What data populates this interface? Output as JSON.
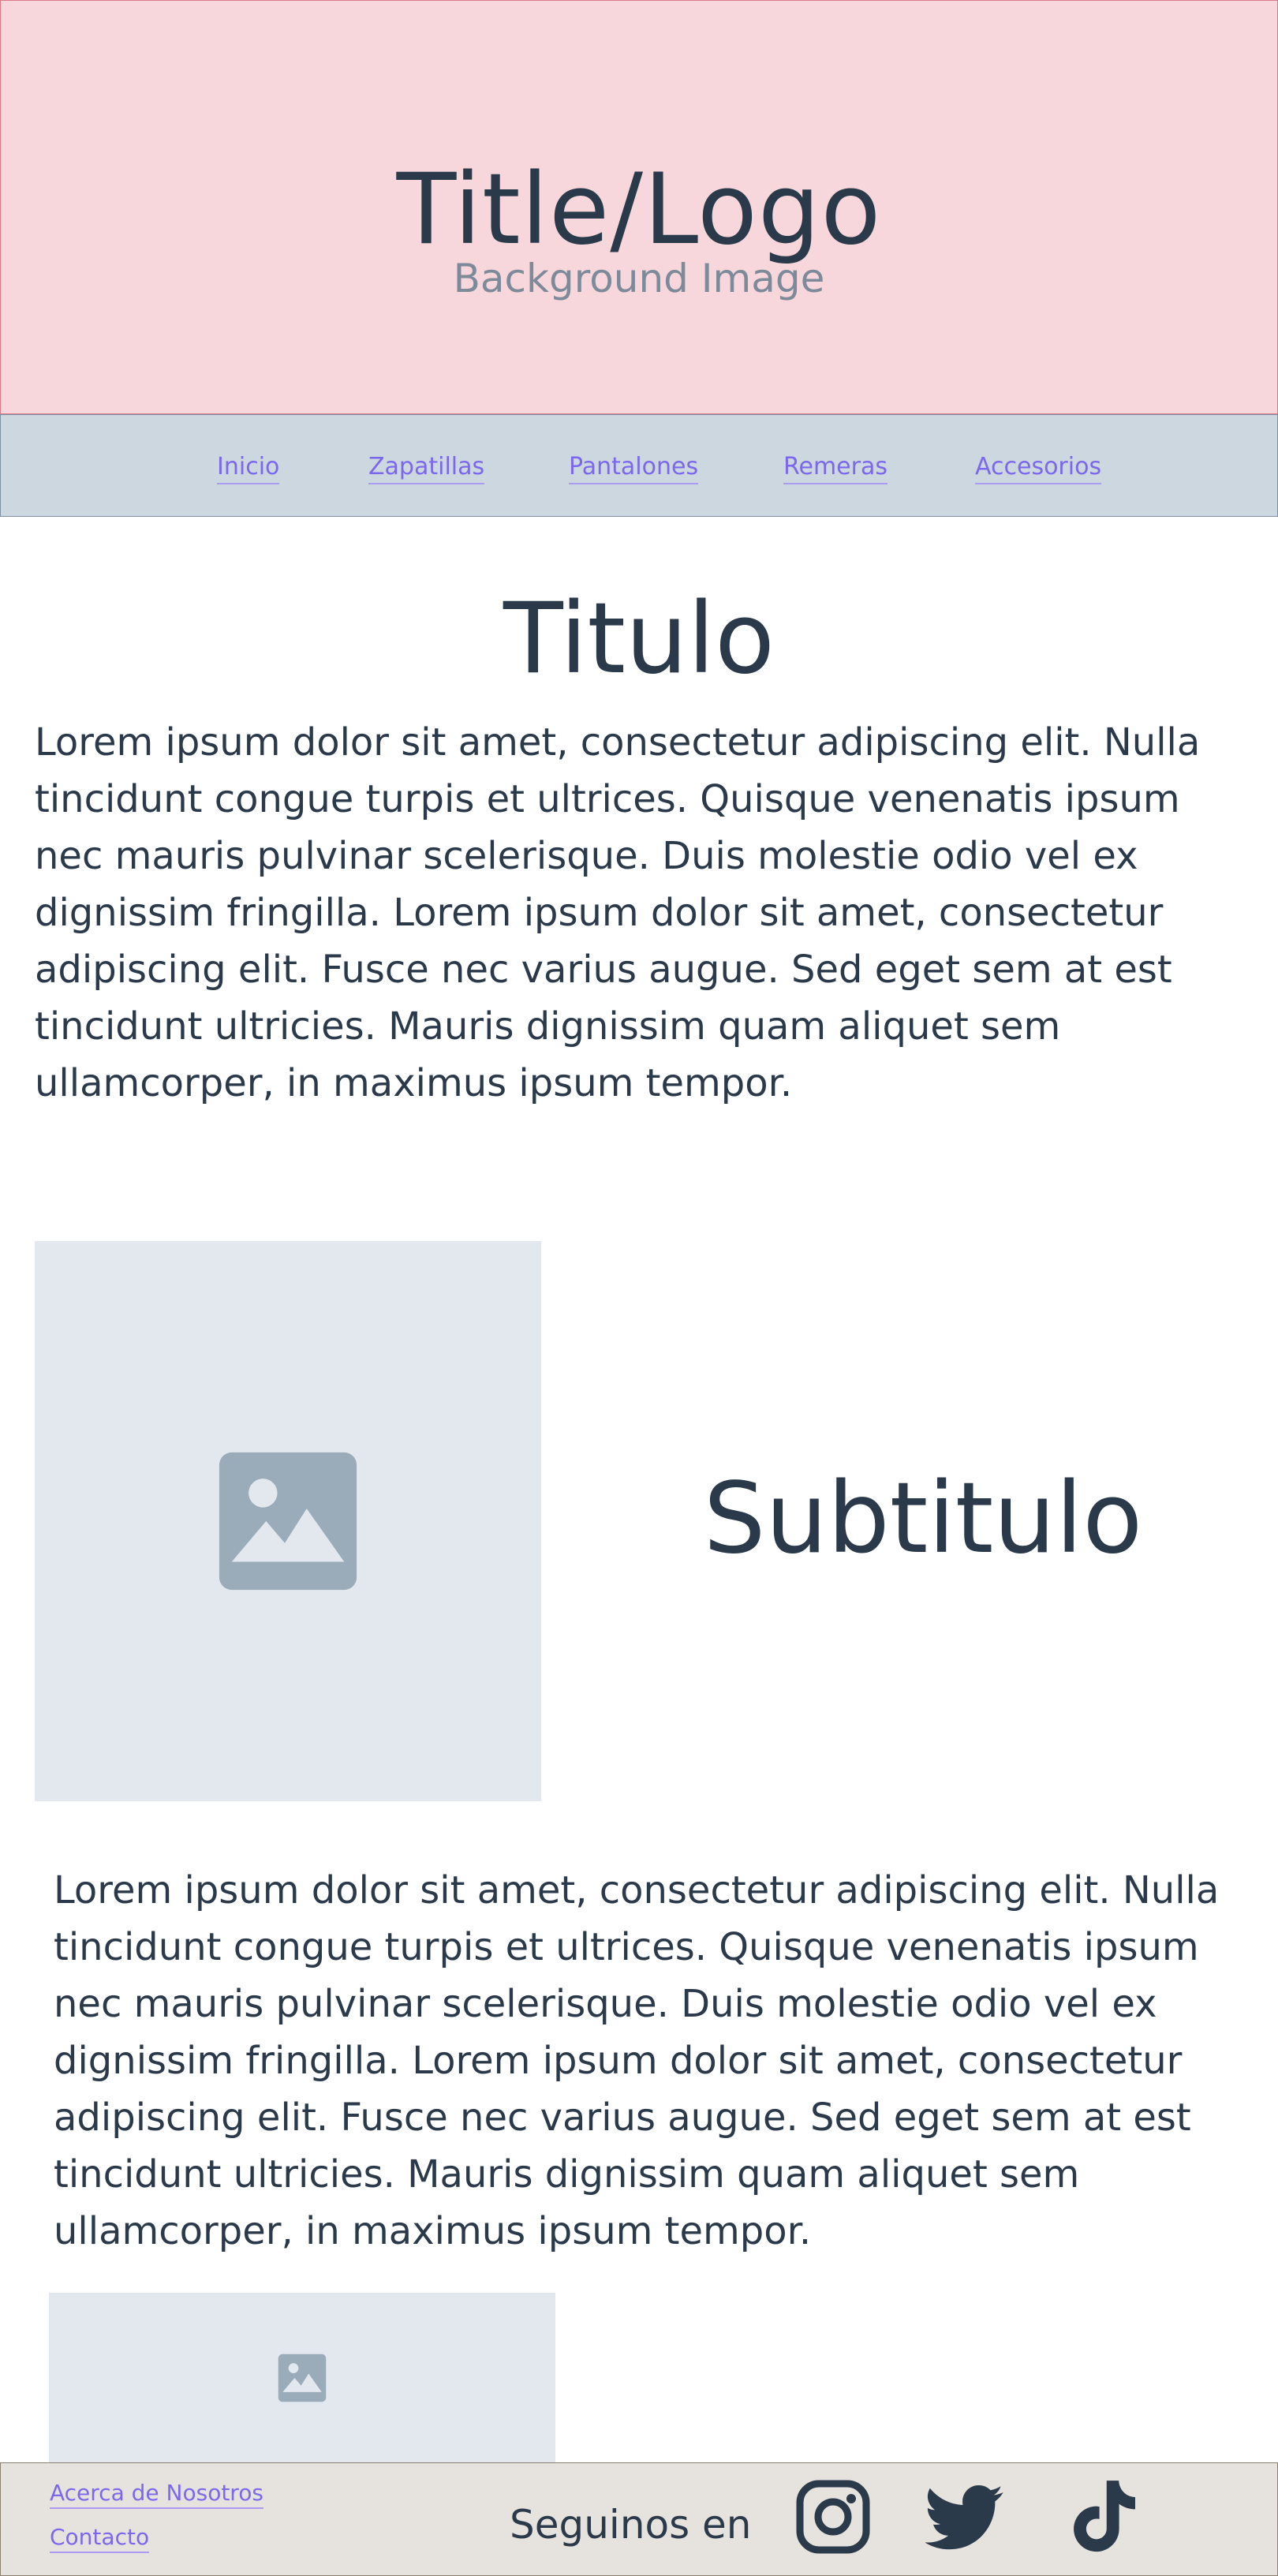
{
  "header": {
    "title": "Title/Logo",
    "subtitle": "Background Image"
  },
  "nav": {
    "items": [
      {
        "label": "Inicio"
      },
      {
        "label": "Zapatillas"
      },
      {
        "label": "Pantalones"
      },
      {
        "label": "Remeras"
      },
      {
        "label": "Accesorios"
      }
    ]
  },
  "main": {
    "title": "Titulo",
    "paragraph1": "Lorem ipsum dolor sit amet, consectetur adipiscing elit. Nulla tincidunt congue turpis et ultrices. Quisque venenatis ipsum nec mauris pulvinar scelerisque. Duis molestie odio vel ex dignissim fringilla. Lorem ipsum dolor sit amet, consectetur adipiscing elit. Fusce nec varius augue. Sed eget sem at est tincidunt ultricies. Mauris dignissim quam aliquet sem ullamcorper, in maximus ipsum tempor.",
    "subtitle": "Subtitulo",
    "paragraph2": "Lorem ipsum dolor sit amet, consectetur adipiscing elit. Nulla tincidunt congue turpis et ultrices. Quisque venenatis ipsum nec mauris pulvinar scelerisque. Duis molestie odio vel ex dignissim fringilla. Lorem ipsum dolor sit amet, consectetur adipiscing elit. Fusce nec varius augue. Sed eget sem at est tincidunt ultricies. Mauris dignissim quam aliquet sem ullamcorper, in maximus ipsum tempor."
  },
  "footer": {
    "links": [
      {
        "label": "Acerca de Nosotros"
      },
      {
        "label": "Contacto"
      }
    ],
    "follow_text": "Seguinos en",
    "social_icons": [
      "instagram-icon",
      "twitter-icon",
      "tiktok-icon"
    ]
  },
  "colors": {
    "header_bg": "#f7d7dc",
    "nav_bg": "#cdd7e0",
    "footer_bg": "#e6e3df",
    "link": "#7b68ee",
    "text": "#2b3a4a",
    "placeholder_bg": "#e2e8ee",
    "placeholder_icon": "#9aabba"
  }
}
